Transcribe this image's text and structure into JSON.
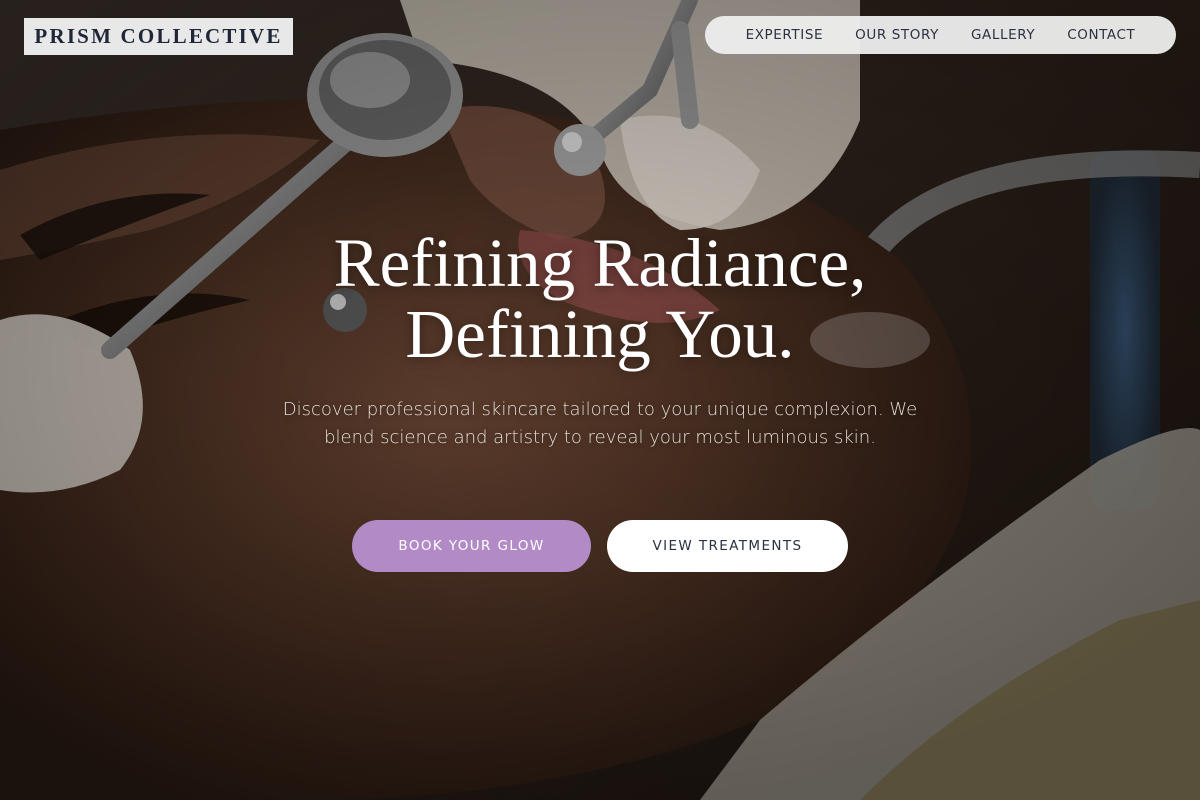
{
  "header": {
    "logo_text": "PRISM COLLECTIVE",
    "nav": [
      {
        "label": "EXPERTISE"
      },
      {
        "label": "OUR STORY"
      },
      {
        "label": "GALLERY"
      },
      {
        "label": "CONTACT"
      }
    ]
  },
  "hero": {
    "headline_line1": "Refining Radiance,",
    "headline_line2": "Defining You.",
    "subtext": "Discover professional skincare tailored to your unique complexion. We blend science and artistry to reveal your most luminous skin.",
    "primary_button": "BOOK YOUR GLOW",
    "secondary_button": "VIEW TREATMENTS",
    "background_image": "facial-treatment-photo"
  },
  "colors": {
    "accent": "#b18ac6",
    "logo_text": "#1e2637",
    "nav_text": "#2b3240",
    "header_bg": "#eeeeee"
  }
}
